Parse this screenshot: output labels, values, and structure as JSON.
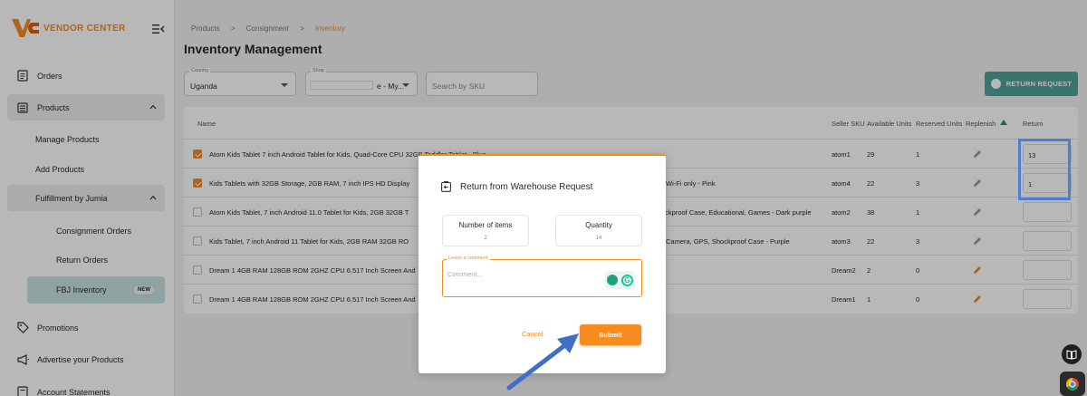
{
  "brand": {
    "name": "VENDOR CENTER",
    "accent": "#f68b1e",
    "teal": "#4fa39a"
  },
  "sidebar": {
    "items": [
      {
        "label": "Orders",
        "icon": "orders-icon"
      },
      {
        "label": "Products",
        "icon": "products-icon"
      },
      {
        "label": "Manage Products"
      },
      {
        "label": "Add Products"
      },
      {
        "label": "Fulfillment by Jumia"
      },
      {
        "label": "Consignment Orders"
      },
      {
        "label": "Return Orders"
      },
      {
        "label": "FBJ Inventory",
        "badge": "NEW"
      },
      {
        "label": "Promotions",
        "icon": "tag-icon"
      },
      {
        "label": "Advertise your Products",
        "icon": "megaphone-icon"
      },
      {
        "label": "Account Statements",
        "icon": "statement-icon"
      }
    ]
  },
  "breadcrumb": [
    "Products",
    ">",
    "Consignment",
    ">",
    "Inventory"
  ],
  "page_title": "Inventory Management",
  "filters": {
    "country_label": "Country",
    "country_value": "Uganda",
    "shop_label": "Shop",
    "shop_value": "e - My...",
    "search_placeholder": "Search by SKU"
  },
  "return_request_label": "RETURN REQUEST",
  "table": {
    "headers": [
      "Name",
      "Seller SKU",
      "Available Units",
      "Reserved Units",
      "Replenish",
      "Return"
    ],
    "rows": [
      {
        "checked": true,
        "name": "Atom Kids Tablet 7 inch Android Tablet for Kids, Quad-Core CPU 32GB Toddler Tablet - Blue",
        "name_tail": "",
        "sku": "atom1",
        "available": "29",
        "reserved": "1",
        "return": "13",
        "pen_active": false
      },
      {
        "checked": true,
        "name": "Kids Tablets with 32GB Storage, 2GB RAM, 7 inch IPS HD Display",
        "name_tail": "Wi-Fi only - Pink",
        "sku": "atom4",
        "available": "22",
        "reserved": "3",
        "return": "1",
        "pen_active": false
      },
      {
        "checked": false,
        "name": "Atom Kids Tablet, 7 inch Android 11.0 Tablet for Kids, 2GB 32GB T",
        "name_tail": "ockproof Case, Educational, Games - Dark purple",
        "sku": "atom2",
        "available": "38",
        "reserved": "1",
        "return": "",
        "pen_active": false
      },
      {
        "checked": false,
        "name": "Kids Tablet, 7 inch Android 11 Tablet for Kids, 2GB RAM 32GB RO",
        "name_tail": "Camera, GPS, Shockproof Case - Purple",
        "sku": "atom3",
        "available": "22",
        "reserved": "3",
        "return": "",
        "pen_active": false
      },
      {
        "checked": false,
        "name": "Dream 1 4GB RAM 128GB ROM 2GHZ CPU 6.517 Inch Screen And",
        "name_tail": "",
        "sku": "Dream2",
        "available": "2",
        "reserved": "0",
        "return": "",
        "pen_active": true
      },
      {
        "checked": false,
        "name": "Dream 1 4GB RAM 128GB ROM 2GHZ CPU 6.517 Inch Screen And",
        "name_tail": "",
        "sku": "Dream1",
        "available": "1",
        "reserved": "0",
        "return": "",
        "pen_active": true
      }
    ]
  },
  "modal": {
    "title": "Return from Warehouse Request",
    "items_label": "Number of items",
    "items_value": "2",
    "qty_label": "Quantity",
    "qty_value": "14",
    "comment_label": "Leave a comment",
    "comment_placeholder": "Comment...",
    "cancel": "Cancel",
    "submit": "Submit"
  }
}
